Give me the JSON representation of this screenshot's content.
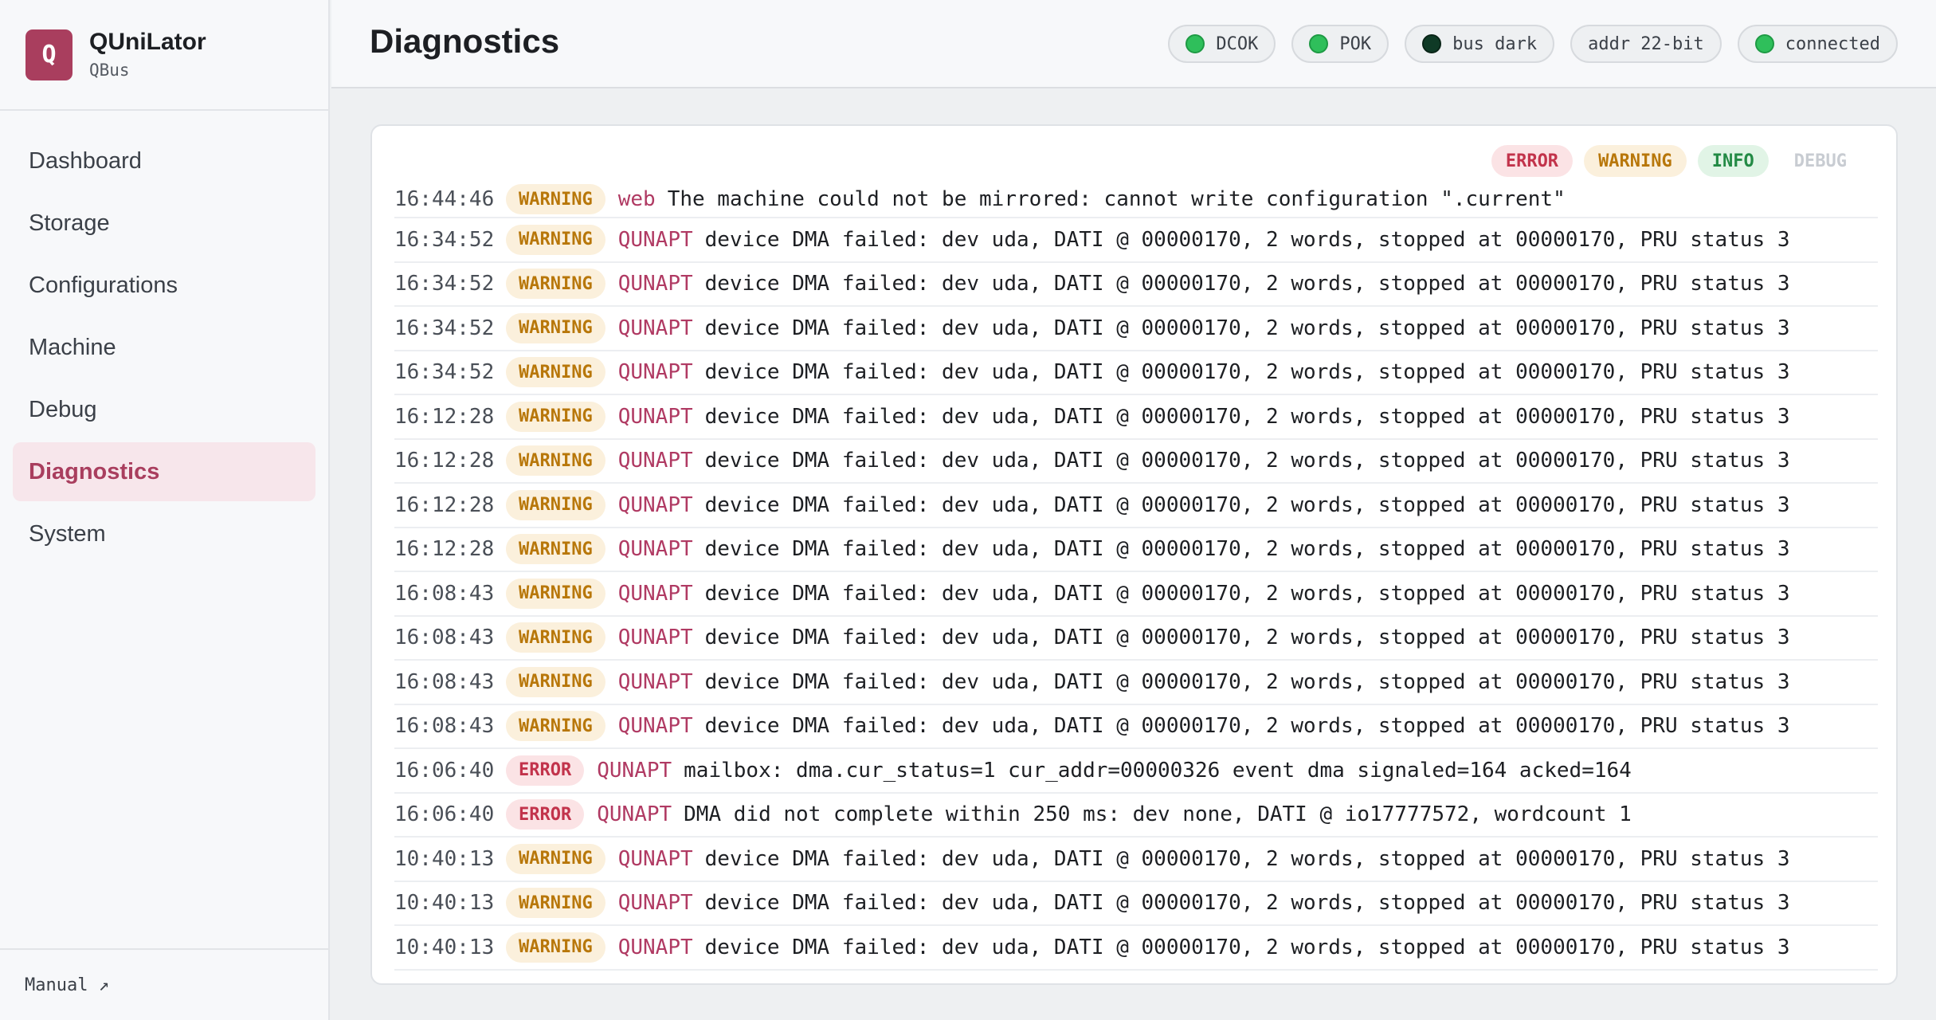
{
  "app": {
    "name": "QUniLator",
    "subtitle": "QBus",
    "logo_letter": "Q",
    "accent": "#a93e5e"
  },
  "sidebar": {
    "items": [
      {
        "label": "Dashboard",
        "active": false
      },
      {
        "label": "Storage",
        "active": false
      },
      {
        "label": "Configurations",
        "active": false
      },
      {
        "label": "Machine",
        "active": false
      },
      {
        "label": "Debug",
        "active": false
      },
      {
        "label": "Diagnostics",
        "active": true
      },
      {
        "label": "System",
        "active": false
      }
    ],
    "footer_link": "Manual ↗"
  },
  "header": {
    "title": "Diagnostics",
    "status_pills": [
      {
        "label": "DCOK",
        "indicator": "green"
      },
      {
        "label": "POK",
        "indicator": "green"
      },
      {
        "label": "bus dark",
        "indicator": "dark"
      },
      {
        "label": "addr 22-bit",
        "indicator": ""
      },
      {
        "label": "connected",
        "indicator": "green"
      }
    ]
  },
  "filters": {
    "error": "ERROR",
    "warning": "WARNING",
    "info": "INFO",
    "debug": "DEBUG"
  },
  "log": [
    {
      "time": "16:44:46",
      "level": "WARNING",
      "source": "web",
      "message": "The machine could not be mirrored: cannot write configuration \".current\""
    },
    {
      "time": "16:34:52",
      "level": "WARNING",
      "source": "QUNAPT",
      "message": "device DMA failed: dev uda, DATI @ 00000170, 2 words, stopped at 00000170, PRU status 3"
    },
    {
      "time": "16:34:52",
      "level": "WARNING",
      "source": "QUNAPT",
      "message": "device DMA failed: dev uda, DATI @ 00000170, 2 words, stopped at 00000170, PRU status 3"
    },
    {
      "time": "16:34:52",
      "level": "WARNING",
      "source": "QUNAPT",
      "message": "device DMA failed: dev uda, DATI @ 00000170, 2 words, stopped at 00000170, PRU status 3"
    },
    {
      "time": "16:34:52",
      "level": "WARNING",
      "source": "QUNAPT",
      "message": "device DMA failed: dev uda, DATI @ 00000170, 2 words, stopped at 00000170, PRU status 3"
    },
    {
      "time": "16:12:28",
      "level": "WARNING",
      "source": "QUNAPT",
      "message": "device DMA failed: dev uda, DATI @ 00000170, 2 words, stopped at 00000170, PRU status 3"
    },
    {
      "time": "16:12:28",
      "level": "WARNING",
      "source": "QUNAPT",
      "message": "device DMA failed: dev uda, DATI @ 00000170, 2 words, stopped at 00000170, PRU status 3"
    },
    {
      "time": "16:12:28",
      "level": "WARNING",
      "source": "QUNAPT",
      "message": "device DMA failed: dev uda, DATI @ 00000170, 2 words, stopped at 00000170, PRU status 3"
    },
    {
      "time": "16:12:28",
      "level": "WARNING",
      "source": "QUNAPT",
      "message": "device DMA failed: dev uda, DATI @ 00000170, 2 words, stopped at 00000170, PRU status 3"
    },
    {
      "time": "16:08:43",
      "level": "WARNING",
      "source": "QUNAPT",
      "message": "device DMA failed: dev uda, DATI @ 00000170, 2 words, stopped at 00000170, PRU status 3"
    },
    {
      "time": "16:08:43",
      "level": "WARNING",
      "source": "QUNAPT",
      "message": "device DMA failed: dev uda, DATI @ 00000170, 2 words, stopped at 00000170, PRU status 3"
    },
    {
      "time": "16:08:43",
      "level": "WARNING",
      "source": "QUNAPT",
      "message": "device DMA failed: dev uda, DATI @ 00000170, 2 words, stopped at 00000170, PRU status 3"
    },
    {
      "time": "16:08:43",
      "level": "WARNING",
      "source": "QUNAPT",
      "message": "device DMA failed: dev uda, DATI @ 00000170, 2 words, stopped at 00000170, PRU status 3"
    },
    {
      "time": "16:06:40",
      "level": "ERROR",
      "source": "QUNAPT",
      "message": "mailbox: dma.cur_status=1 cur_addr=00000326 event dma signaled=164 acked=164"
    },
    {
      "time": "16:06:40",
      "level": "ERROR",
      "source": "QUNAPT",
      "message": "DMA did not complete within 250 ms: dev none, DATI @ io17777572, wordcount 1"
    },
    {
      "time": "10:40:13",
      "level": "WARNING",
      "source": "QUNAPT",
      "message": "device DMA failed: dev uda, DATI @ 00000170, 2 words, stopped at 00000170, PRU status 3"
    },
    {
      "time": "10:40:13",
      "level": "WARNING",
      "source": "QUNAPT",
      "message": "device DMA failed: dev uda, DATI @ 00000170, 2 words, stopped at 00000170, PRU status 3"
    },
    {
      "time": "10:40:13",
      "level": "WARNING",
      "source": "QUNAPT",
      "message": "device DMA failed: dev uda, DATI @ 00000170, 2 words, stopped at 00000170, PRU status 3"
    }
  ]
}
